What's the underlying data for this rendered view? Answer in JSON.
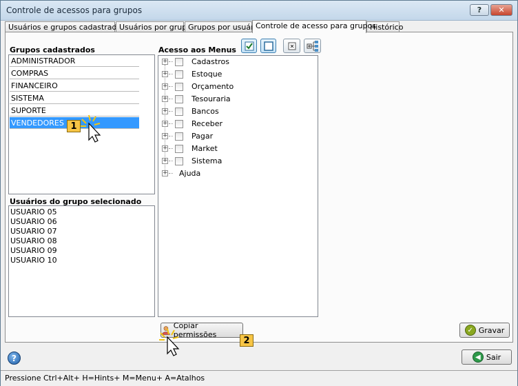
{
  "window": {
    "title": "Controle de acessos para grupos",
    "help_label": "?",
    "close_label": "✕"
  },
  "tabs": [
    {
      "label": "Usuários e grupos cadastrados"
    },
    {
      "label": "Usuários por grupo"
    },
    {
      "label": "Grupos por usuário"
    },
    {
      "label": "Controle de acesso para grupos",
      "active": true
    },
    {
      "label": "Histórico"
    }
  ],
  "groups": {
    "label": "Grupos cadastrados",
    "items": [
      "ADMINISTRADOR",
      "COMPRAS",
      "FINANCEIRO",
      "SISTEMA",
      "SUPORTE",
      "VENDEDORES"
    ],
    "selected": "VENDEDORES"
  },
  "users": {
    "label": "Usuários do grupo selecionado",
    "items": [
      "USUARIO 05",
      "USUARIO 06",
      "USUARIO 07",
      "USUARIO 08",
      "USUARIO 09",
      "USUARIO 10"
    ]
  },
  "menu_access": {
    "label": "Acesso aos Menus",
    "items": [
      {
        "label": "Cadastros",
        "checkbox": true
      },
      {
        "label": "Estoque",
        "checkbox": true
      },
      {
        "label": "Orçamento",
        "checkbox": true
      },
      {
        "label": "Tesouraria",
        "checkbox": true
      },
      {
        "label": "Bancos",
        "checkbox": true
      },
      {
        "label": "Receber",
        "checkbox": true
      },
      {
        "label": "Pagar",
        "checkbox": true
      },
      {
        "label": "Market",
        "checkbox": true
      },
      {
        "label": "Sistema",
        "checkbox": true
      },
      {
        "label": "Ajuda",
        "checkbox": false
      }
    ]
  },
  "buttons": {
    "copy_label": "Copiar permissões",
    "save_label": "Gravar",
    "exit_label": "Sair"
  },
  "callouts": {
    "first": "1",
    "second": "2"
  },
  "status": {
    "text": "Pressione Ctrl+Alt+ H=Hints+ M=Menu+ A=Atalhos"
  },
  "colors": {
    "selection": "#3399ff",
    "callout": "#f7c545"
  }
}
